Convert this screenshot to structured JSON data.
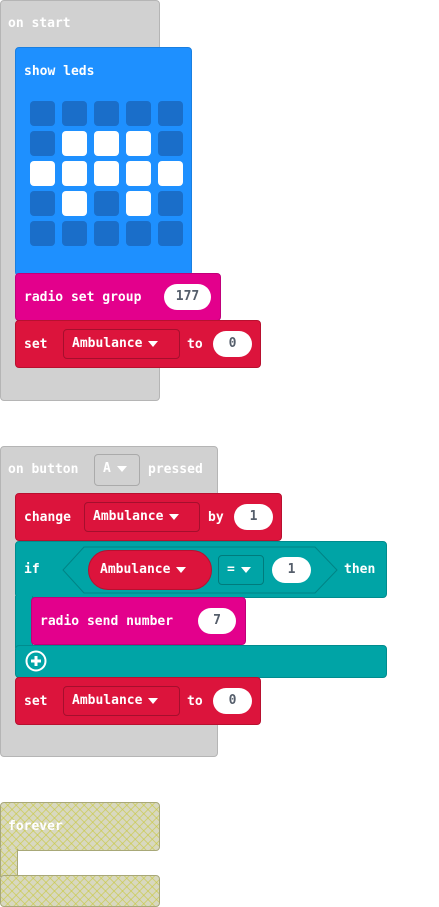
{
  "on_start": {
    "label": "on start",
    "show_leds": {
      "label": "show leds",
      "grid": [
        [
          0,
          0,
          0,
          0,
          0
        ],
        [
          0,
          1,
          1,
          1,
          0
        ],
        [
          1,
          1,
          1,
          1,
          1
        ],
        [
          0,
          1,
          0,
          1,
          0
        ],
        [
          0,
          0,
          0,
          0,
          0
        ]
      ]
    },
    "radio_set_group": {
      "label": "radio set group",
      "value": "177"
    },
    "set_var": {
      "label": "set",
      "variable": "Ambulance",
      "to_label": "to",
      "value": "0"
    }
  },
  "on_button": {
    "label_on": "on button",
    "button": "A",
    "label_pressed": "pressed",
    "change": {
      "label": "change",
      "variable": "Ambulance",
      "by_label": "by",
      "value": "1"
    },
    "if_block": {
      "if_label": "if",
      "variable": "Ambulance",
      "operator": "=",
      "value": "1",
      "then_label": "then",
      "radio_send": {
        "label": "radio send number",
        "value": "7"
      }
    },
    "set_var": {
      "label": "set",
      "variable": "Ambulance",
      "to_label": "to",
      "value": "0"
    }
  },
  "forever": {
    "label": "forever"
  },
  "colors": {
    "basic": "#1e90ff",
    "radio": "#e3008c",
    "variables": "#dc143c",
    "logic": "#00a4a6",
    "events": "#d1d1d1"
  }
}
